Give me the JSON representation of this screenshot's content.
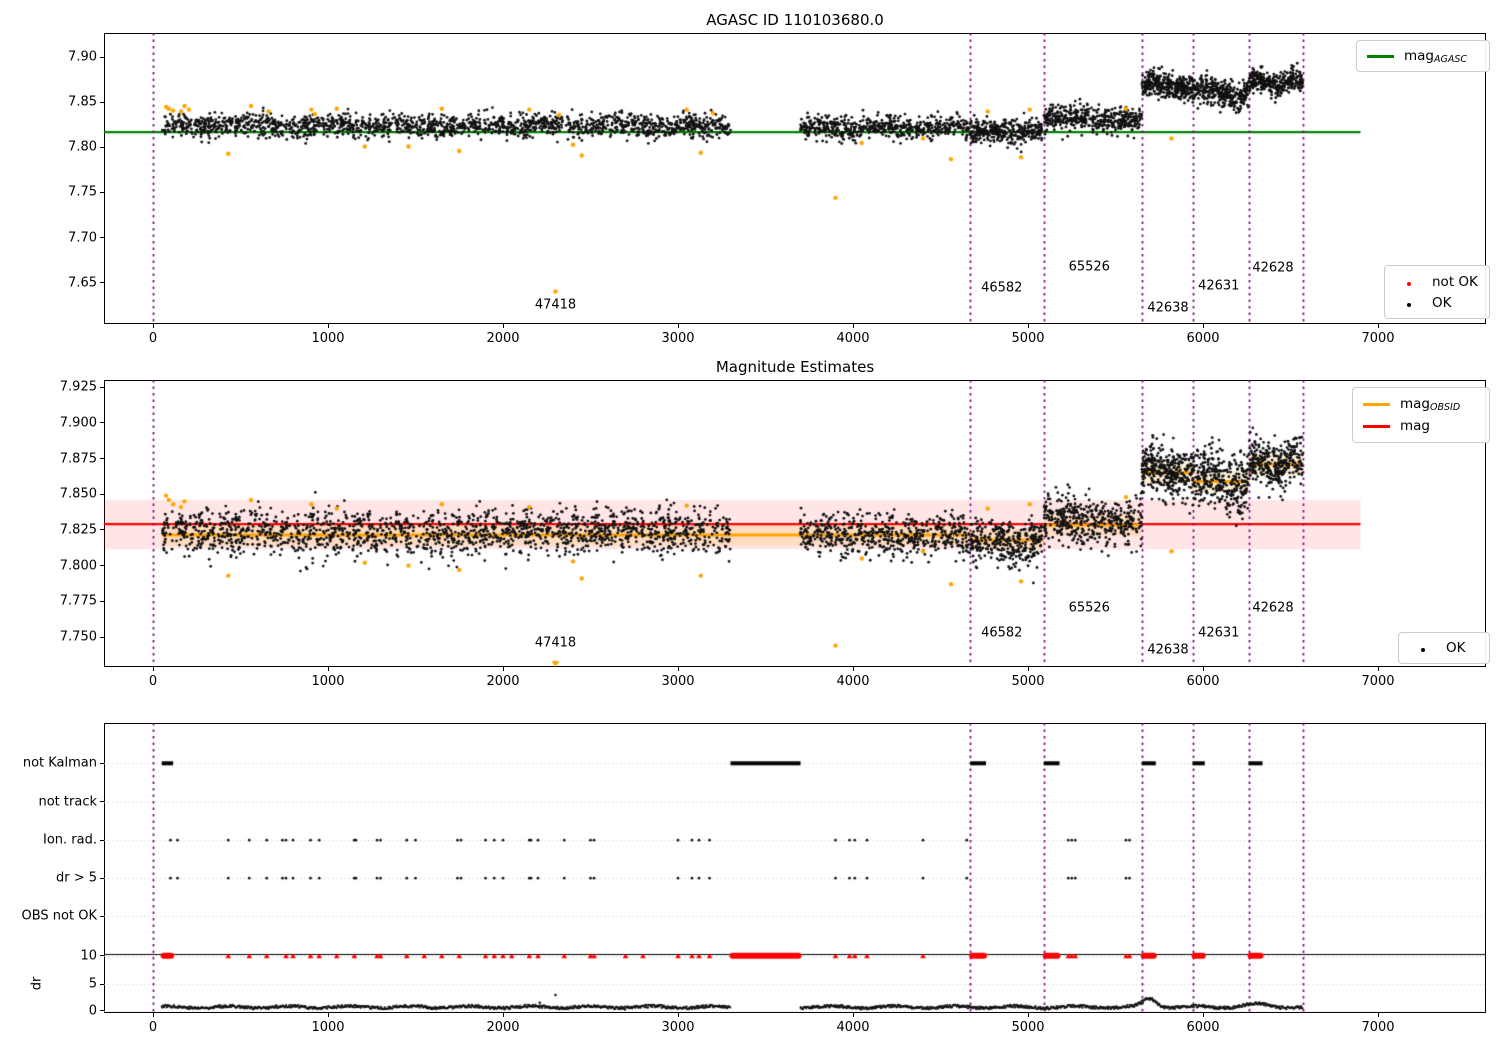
{
  "colors": {
    "green": "#008000",
    "red": "#ff0000",
    "orange": "#ffa500",
    "purple": "#800080",
    "black": "#000000",
    "pink_band": "rgba(255,0,0,0.10)",
    "orange_band": "rgba(255,165,0,0.16)",
    "grid": "#c8c8c8"
  },
  "chart_data": [
    {
      "type": "scatter",
      "title": "AGASC ID 110103680.0",
      "xlim": [
        -280,
        7617
      ],
      "ylim": [
        7.604,
        7.927
      ],
      "xticks": [
        "0",
        "1000",
        "2000",
        "3000",
        "4000",
        "5000",
        "6000",
        "7000"
      ],
      "xtick_values": [
        0,
        1000,
        2000,
        3000,
        4000,
        5000,
        6000,
        7000
      ],
      "yticks": [
        "7.90",
        "7.85",
        "7.80",
        "7.75",
        "7.70",
        "7.65"
      ],
      "ytick_values": [
        7.9,
        7.85,
        7.8,
        7.75,
        7.7,
        7.65
      ],
      "hline": {
        "value": 7.817,
        "x0": -280,
        "x1": 6900,
        "color_key": "green"
      },
      "vlines": {
        "x": [
          0,
          4670,
          5090,
          5650,
          5940,
          6260,
          6570
        ],
        "color_key": "purple"
      },
      "clusters": [
        [
          50,
          3300,
          7.824,
          0.0065,
          1700,
          0.003,
          420
        ],
        [
          3700,
          4670,
          7.822,
          0.0065,
          560,
          0.003,
          380
        ],
        [
          4670,
          5080,
          7.817,
          0.0065,
          330,
          0.002,
          300
        ],
        [
          5090,
          5650,
          7.8315,
          0.0075,
          430,
          0.004,
          560
        ],
        [
          5650,
          5940,
          7.868,
          0.007,
          340,
          0.006,
          290
        ],
        [
          5940,
          6260,
          7.861,
          0.008,
          340,
          0.009,
          320
        ],
        [
          6260,
          6570,
          7.872,
          0.006,
          330,
          0.007,
          200
        ]
      ],
      "outliers_orange": [
        [
          75,
          7.845
        ],
        [
          90,
          7.843
        ],
        [
          115,
          7.841
        ],
        [
          160,
          7.84
        ],
        [
          180,
          7.846
        ],
        [
          205,
          7.842
        ],
        [
          430,
          7.793
        ],
        [
          560,
          7.846
        ],
        [
          660,
          7.84
        ],
        [
          905,
          7.842
        ],
        [
          925,
          7.837
        ],
        [
          1050,
          7.843
        ],
        [
          1210,
          7.801
        ],
        [
          1460,
          7.801
        ],
        [
          1650,
          7.843
        ],
        [
          1750,
          7.796
        ],
        [
          2150,
          7.842
        ],
        [
          2300,
          7.64
        ],
        [
          2320,
          7.836
        ],
        [
          2400,
          7.803
        ],
        [
          2450,
          7.791
        ],
        [
          3050,
          7.842
        ],
        [
          3130,
          7.794
        ],
        [
          3200,
          7.838
        ],
        [
          3900,
          7.744
        ],
        [
          4050,
          7.805
        ],
        [
          4400,
          7.81
        ],
        [
          4560,
          7.787
        ],
        [
          4770,
          7.84
        ],
        [
          4960,
          7.789
        ],
        [
          5010,
          7.842
        ],
        [
          5560,
          7.843
        ],
        [
          5820,
          7.81
        ]
      ],
      "annotations": [
        {
          "text": "47418",
          "x": 2300,
          "y": 7.625
        },
        {
          "text": "46582",
          "x": 4850,
          "y": 7.644
        },
        {
          "text": "65526",
          "x": 5350,
          "y": 7.667
        },
        {
          "text": "42638",
          "x": 5800,
          "y": 7.622
        },
        {
          "text": "42631",
          "x": 6090,
          "y": 7.646
        },
        {
          "text": "42628",
          "x": 6400,
          "y": 7.666
        }
      ],
      "legend_top": {
        "entries": [
          {
            "kind": "line",
            "color_key": "green",
            "label_main": "mag",
            "label_sub": "AGASC"
          }
        ]
      },
      "legend_bottom": {
        "entries": [
          {
            "kind": "dot",
            "color_key": "red",
            "label": "not OK"
          },
          {
            "kind": "dot",
            "color_key": "black",
            "label": "OK"
          }
        ]
      }
    },
    {
      "type": "scatter",
      "title": "Magnitude Estimates",
      "xlim": [
        -280,
        7617
      ],
      "ylim": [
        7.729,
        7.93
      ],
      "xticks": [
        "0",
        "1000",
        "2000",
        "3000",
        "4000",
        "5000",
        "6000",
        "7000"
      ],
      "xtick_values": [
        0,
        1000,
        2000,
        3000,
        4000,
        5000,
        6000,
        7000
      ],
      "yticks": [
        "7.925",
        "7.900",
        "7.875",
        "7.850",
        "7.825",
        "7.800",
        "7.775",
        "7.750"
      ],
      "ytick_values": [
        7.925,
        7.9,
        7.875,
        7.85,
        7.825,
        7.8,
        7.775,
        7.75
      ],
      "hline": {
        "value": 7.829,
        "x0": -280,
        "x1": 6900,
        "color_key": "red"
      },
      "band": {
        "y0": 7.8115,
        "y1": 7.846,
        "x0": -280,
        "x1": 6900,
        "color_key": "pink_band"
      },
      "step_segments": [
        [
          50,
          4670,
          7.8215
        ],
        [
          4670,
          5090,
          7.818
        ],
        [
          5090,
          5650,
          7.8285
        ],
        [
          5650,
          5940,
          7.865
        ],
        [
          5940,
          6260,
          7.859
        ],
        [
          6260,
          6570,
          7.871
        ]
      ],
      "step_band_halfwidth": 0.0075,
      "vlines": {
        "x": [
          0,
          4670,
          5090,
          5650,
          5940,
          6260,
          6570
        ],
        "color_key": "purple"
      },
      "clusters": [
        [
          50,
          3300,
          7.8235,
          0.008,
          1700,
          0.003,
          420
        ],
        [
          3700,
          4670,
          7.821,
          0.008,
          560,
          0.003,
          380
        ],
        [
          4670,
          5080,
          7.8165,
          0.008,
          330,
          0.002,
          300
        ],
        [
          5090,
          5650,
          7.8315,
          0.009,
          430,
          0.004,
          560
        ],
        [
          5650,
          5940,
          7.866,
          0.0085,
          340,
          0.006,
          290
        ],
        [
          5940,
          6260,
          7.859,
          0.01,
          340,
          0.009,
          320
        ],
        [
          6260,
          6570,
          7.871,
          0.008,
          330,
          0.007,
          200
        ]
      ],
      "outliers_orange": [
        [
          75,
          7.849
        ],
        [
          90,
          7.846
        ],
        [
          115,
          7.843
        ],
        [
          160,
          7.841
        ],
        [
          180,
          7.845
        ],
        [
          430,
          7.793
        ],
        [
          560,
          7.846
        ],
        [
          905,
          7.843
        ],
        [
          1050,
          7.84
        ],
        [
          1210,
          7.802
        ],
        [
          1460,
          7.8
        ],
        [
          1650,
          7.843
        ],
        [
          1750,
          7.797
        ],
        [
          2150,
          7.841
        ],
        [
          2400,
          7.803
        ],
        [
          2450,
          7.791
        ],
        [
          3050,
          7.842
        ],
        [
          3130,
          7.793
        ],
        [
          3900,
          7.744
        ],
        [
          4050,
          7.805
        ],
        [
          4400,
          7.81
        ],
        [
          4560,
          7.787
        ],
        [
          4770,
          7.84
        ],
        [
          4960,
          7.789
        ],
        [
          5010,
          7.843
        ],
        [
          5560,
          7.848
        ],
        [
          5820,
          7.81
        ]
      ],
      "clip_marker": {
        "x": 2300,
        "shape": "triangle-down",
        "color_key": "orange"
      },
      "annotations": [
        {
          "text": "47418",
          "x": 2300,
          "y": 7.746
        },
        {
          "text": "46582",
          "x": 4850,
          "y": 7.753
        },
        {
          "text": "65526",
          "x": 5350,
          "y": 7.77
        },
        {
          "text": "42638",
          "x": 5800,
          "y": 7.741
        },
        {
          "text": "42631",
          "x": 6090,
          "y": 7.753
        },
        {
          "text": "42628",
          "x": 6400,
          "y": 7.77
        }
      ],
      "legend_top": {
        "entries": [
          {
            "kind": "line",
            "color_key": "orange",
            "label_main": "mag",
            "label_sub": "OBSID"
          },
          {
            "kind": "line",
            "color_key": "red",
            "label_main": "mag",
            "label_sub": ""
          }
        ]
      },
      "legend_bottom": {
        "entries": [
          {
            "kind": "dot",
            "color_key": "black",
            "label": "OK"
          }
        ]
      }
    },
    {
      "type": "event-rows",
      "ylabel": "dr",
      "xlim": [
        -280,
        7617
      ],
      "xticks": [
        "0",
        "1000",
        "2000",
        "3000",
        "4000",
        "5000",
        "6000",
        "7000"
      ],
      "xtick_values": [
        0,
        1000,
        2000,
        3000,
        4000,
        5000,
        6000,
        7000
      ],
      "row_labels": [
        "not Kalman",
        "not track",
        "Ion. rad.",
        "dr > 5",
        "OBS not OK"
      ],
      "dr_ticks": [
        "10",
        "5",
        "0"
      ],
      "vlines": {
        "x": [
          0,
          4670,
          5090,
          5650,
          5940,
          6260,
          6570
        ],
        "color_key": "purple"
      },
      "not_kalman_blocks": [
        [
          50,
          115
        ],
        [
          3300,
          3700
        ],
        [
          4670,
          4760
        ],
        [
          5090,
          5180
        ],
        [
          5650,
          5730
        ],
        [
          5940,
          6010
        ],
        [
          6260,
          6340
        ]
      ],
      "ion_rad_x": [
        100,
        140,
        430,
        550,
        650,
        740,
        760,
        800,
        900,
        950,
        1150,
        1160,
        1280,
        1300,
        1450,
        1500,
        1740,
        1760,
        1900,
        1950,
        2000,
        2150,
        2160,
        2200,
        2350,
        2500,
        2520,
        3000,
        3080,
        3120,
        3180,
        3900,
        3980,
        4010,
        4080,
        4400,
        4650,
        5230,
        5250,
        5270,
        5560,
        5580
      ],
      "dr_gt5_x": [
        100,
        140,
        430,
        550,
        650,
        740,
        760,
        800,
        900,
        950,
        1150,
        1160,
        1280,
        1300,
        1450,
        1500,
        1740,
        1760,
        1900,
        1950,
        2000,
        2150,
        2160,
        2200,
        2350,
        2500,
        2520,
        3000,
        3080,
        3120,
        3180,
        3900,
        3980,
        4010,
        4080,
        4400,
        4650,
        5230,
        5250,
        5270,
        5560,
        5580
      ],
      "obs_not_ok_x": [],
      "dr_capped_blocks": [
        [
          50,
          115
        ],
        [
          3300,
          3700
        ],
        [
          4670,
          4760
        ],
        [
          5090,
          5180
        ],
        [
          5650,
          5730
        ],
        [
          5940,
          6010
        ],
        [
          6260,
          6340
        ]
      ],
      "dr_capped_x": [
        430,
        550,
        650,
        760,
        800,
        900,
        950,
        1050,
        1150,
        1280,
        1300,
        1450,
        1550,
        1650,
        1750,
        1900,
        1950,
        2000,
        2050,
        2150,
        2200,
        2350,
        2500,
        2520,
        2700,
        2800,
        3000,
        3080,
        3120,
        3180,
        3900,
        3980,
        4010,
        4080,
        4400,
        5230,
        5250,
        5270,
        5560,
        5580
      ],
      "dr_trace_segments": [
        [
          50,
          3300
        ],
        [
          3700,
          4670
        ],
        [
          4670,
          5090
        ],
        [
          5090,
          5650
        ],
        [
          5650,
          5940
        ],
        [
          5940,
          6260
        ],
        [
          6260,
          6570
        ]
      ],
      "dr_extra_points": [
        [
          2210,
          1.5
        ],
        [
          2300,
          2.9
        ]
      ],
      "dr_axhline": 10
    }
  ]
}
